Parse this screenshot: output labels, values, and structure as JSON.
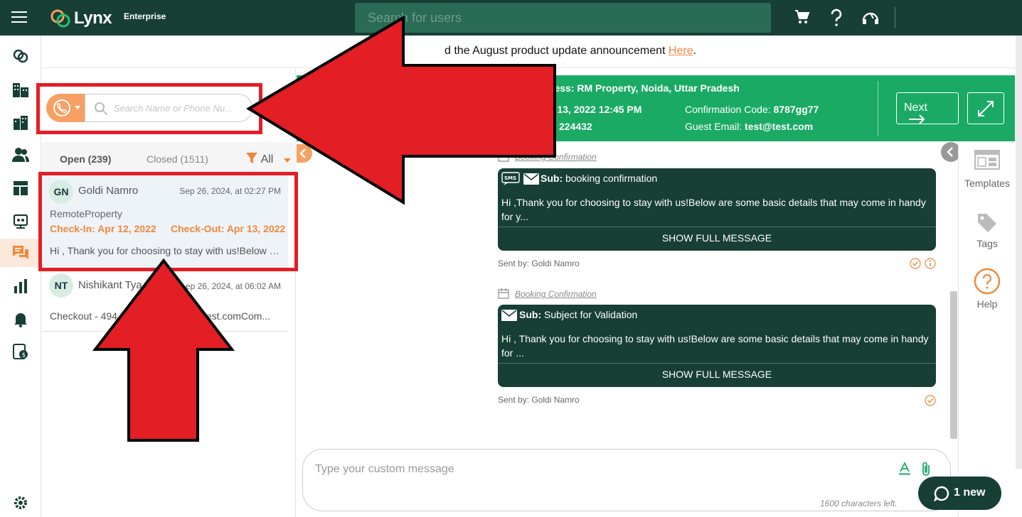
{
  "topbar": {
    "brand": "Lynx",
    "edition": "Enterprise",
    "search_placeholder": "Search for users",
    "icons": [
      "cart-icon",
      "help-icon",
      "support-icon"
    ]
  },
  "sidebar": {
    "items": [
      "properties-icon",
      "buildings-icon",
      "office-icon",
      "guests-icon",
      "dashboard-icon",
      "automation-icon",
      "messages-icon",
      "reports-icon",
      "notifications-icon",
      "billing-icon",
      "settings-icon"
    ],
    "active": "messages-icon"
  },
  "announcement": {
    "text": "d the August product update announcement ",
    "link": "Here",
    "suffix": "."
  },
  "list": {
    "search_placeholder": "Search Name or Phone Nu...",
    "tabs": {
      "open": "Open (239)",
      "closed": "Closed (1511)"
    },
    "filter": "All",
    "conversations": [
      {
        "initials": "GN",
        "name": "Goldi Namro",
        "date": "Sep 26, 2024, at 02:27 PM",
        "property": "RemoteProperty",
        "checkin": "Check-In: Apr 12, 2022",
        "checkout": "Check-Out: Apr 13, 2022",
        "preview": "Hi , Thank you for choosing to stay with us!Below are some basic details"
      },
      {
        "initials": "NT",
        "name": "Nishikant Tya",
        "date": "ep 26, 2024, at 06:02 AM",
        "preview": "Checkout - 494",
        "preview_tail": "test.comCom..."
      }
    ]
  },
  "booking": {
    "address_label": "ress:",
    "address": "RM Property, Noida, Uttar Pradesh",
    "checkout_frag": "r 13, 2022 12:45 PM",
    "phone_frag": "224432",
    "confirmation_label": "Confirmation Code:",
    "confirmation": "8787gg77",
    "email_label": "Guest Email:",
    "email": "test@test.com",
    "next": "Next"
  },
  "messages": [
    {
      "tag": "Booking Confirmation",
      "channels": [
        "sms-icon",
        "email-icon"
      ],
      "sub_label": "Sub:",
      "subject": "booking confirmation",
      "body": "Hi ,Thank you for choosing to stay with us!Below are some basic details that may come in handy for y...",
      "show": "SHOW FULL MESSAGE",
      "sent_by": "Sent by: Goldi Namro"
    },
    {
      "tag": "Booking Confirmation",
      "channels": [
        "email-icon"
      ],
      "sub_label": "Sub:",
      "subject": "Subject for Validation",
      "body": "Hi , Thank you for choosing to stay with us!Below are some basic details that may come in handy for ...",
      "show": "SHOW FULL MESSAGE",
      "sent_by": "Sent by: Goldi Namro"
    }
  ],
  "tools": {
    "templates": "Templates",
    "tags": "Tags",
    "help": "Help"
  },
  "composer": {
    "placeholder": "Type your custom message",
    "counter": "1600 characters left."
  },
  "chat_widget": {
    "label": "1 new"
  },
  "colors": {
    "brand_dark": "#173f35",
    "accent": "#f0873a",
    "booking_green": "#1aaa64",
    "annotation_red": "#e31e25"
  }
}
